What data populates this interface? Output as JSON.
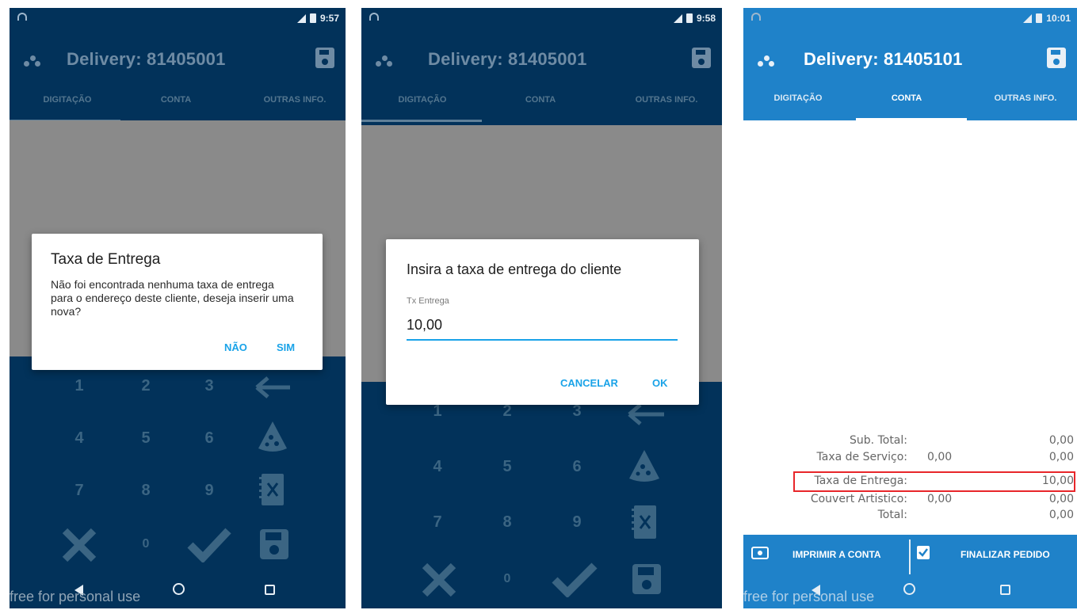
{
  "screens": [
    {
      "status": {
        "time": "9:57"
      },
      "appbar": {
        "title": "Delivery: 81405001"
      },
      "tabs": [
        "DIGITAÇÃO",
        "CONTA",
        "OUTRAS INFO."
      ],
      "dialog": {
        "title": "Taxa de Entrega",
        "message": "Não foi encontrada nenhuma taxa de entrega para o endereço deste cliente, deseja inserir uma nova?",
        "negative": "NÃO",
        "positive": "SIM"
      },
      "keys": [
        "1",
        "2",
        "3",
        "4",
        "5",
        "6",
        "7",
        "8",
        "9",
        "0"
      ],
      "watermark": "free for personal use"
    },
    {
      "status": {
        "time": "9:58"
      },
      "appbar": {
        "title": "Delivery: 81405001"
      },
      "tabs": [
        "DIGITAÇÃO",
        "CONTA",
        "OUTRAS INFO."
      ],
      "dialog": {
        "title": "Insira a taxa de entrega do cliente",
        "field_label": "Tx Entrega",
        "field_value": "10,00",
        "negative": "CANCELAR",
        "positive": "OK"
      },
      "keys": [
        "1",
        "2",
        "3",
        "4",
        "5",
        "6",
        "7",
        "8",
        "9",
        "0"
      ]
    },
    {
      "status": {
        "time": "10:01"
      },
      "appbar": {
        "title": "Delivery: 81405101"
      },
      "tabs": [
        "DIGITAÇÃO",
        "CONTA",
        "OUTRAS INFO."
      ],
      "summary": {
        "subtotal_label": "Sub. Total:",
        "subtotal_value": "0,00",
        "servico_label": "Taxa de Serviço:",
        "servico_mid": "0,00",
        "servico_value": "0,00",
        "entrega_label": "Taxa de Entrega:",
        "entrega_value": "10,00",
        "couvert_label": "Couvert Artistico:",
        "couvert_mid": "0,00",
        "couvert_value": "0,00",
        "total_label": "Total:",
        "total_value": "0,00"
      },
      "actions": {
        "print": "IMPRIMIR A CONTA",
        "finish": "FINALIZAR PEDIDO"
      },
      "watermark": "free for personal use"
    }
  ],
  "colors": {
    "dark_bg": "#02325a",
    "blue_bg": "#1f82c9",
    "accent": "#1aa3e8",
    "highlight": "#e8262a"
  }
}
